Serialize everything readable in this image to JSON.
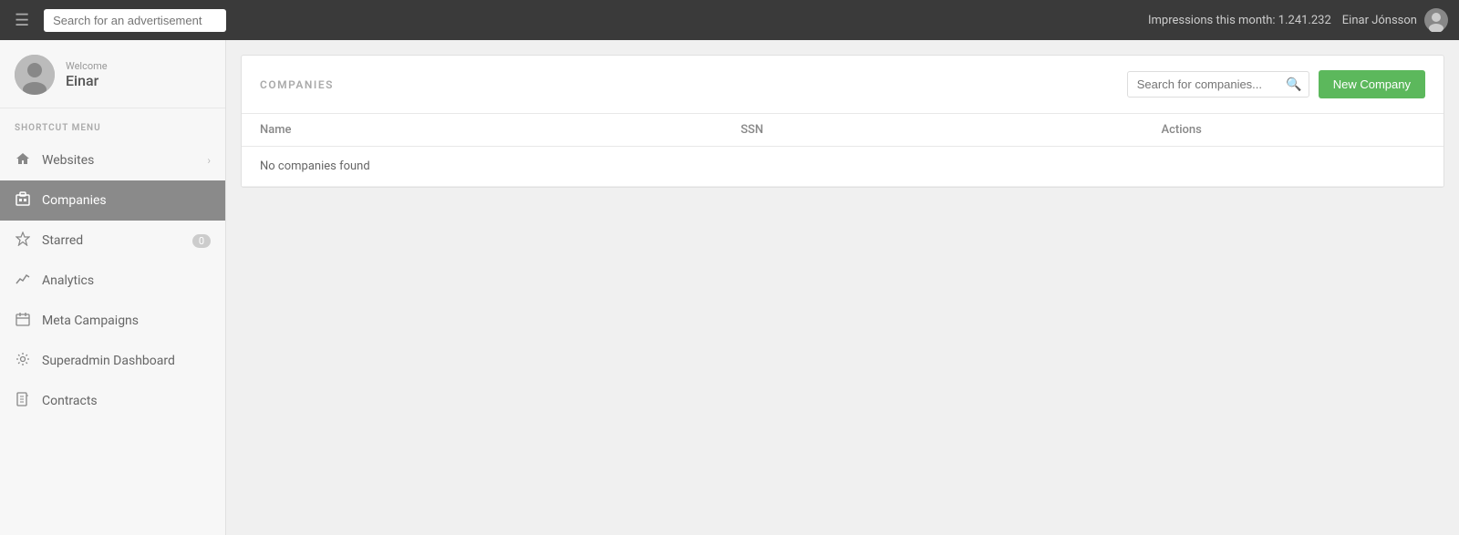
{
  "navbar": {
    "search_placeholder": "Search for an advertisement",
    "impressions_label": "Impressions this month: 1.241.232",
    "user_name": "Einar Jónsson"
  },
  "sidebar": {
    "welcome_label": "Welcome",
    "username": "Einar",
    "section_label": "SHORTCUT MENU",
    "items": [
      {
        "id": "websites",
        "label": "Websites",
        "icon": "🏠",
        "has_chevron": true,
        "badge": null
      },
      {
        "id": "companies",
        "label": "Companies",
        "icon": "🏢",
        "has_chevron": false,
        "badge": null,
        "active": true
      },
      {
        "id": "starred",
        "label": "Starred",
        "icon": "⭐",
        "has_chevron": false,
        "badge": "0"
      },
      {
        "id": "analytics",
        "label": "Analytics",
        "icon": "📈",
        "has_chevron": false,
        "badge": null
      },
      {
        "id": "meta-campaigns",
        "label": "Meta Campaigns",
        "icon": "📅",
        "has_chevron": false,
        "badge": null
      },
      {
        "id": "superadmin",
        "label": "Superadmin Dashboard",
        "icon": "⚙️",
        "has_chevron": false,
        "badge": null
      },
      {
        "id": "contracts",
        "label": "Contracts",
        "icon": "📄",
        "has_chevron": false,
        "badge": null
      }
    ]
  },
  "companies_page": {
    "title": "COMPANIES",
    "search_placeholder": "Search for companies...",
    "new_company_label": "New Company",
    "table": {
      "columns": [
        {
          "id": "name",
          "label": "Name"
        },
        {
          "id": "ssn",
          "label": "SSN"
        },
        {
          "id": "actions",
          "label": "Actions"
        }
      ],
      "rows": [],
      "empty_message": "No companies found"
    }
  }
}
